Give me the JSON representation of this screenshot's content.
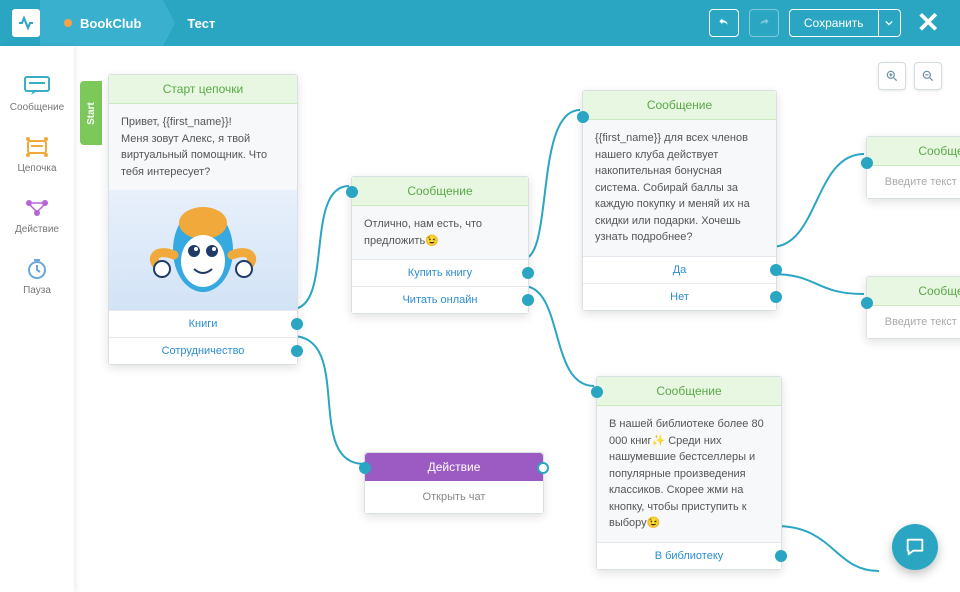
{
  "header": {
    "logo": "⎍",
    "crumb1": "BookClub",
    "crumb2": "Тест",
    "save": "Сохранить"
  },
  "toolbox": {
    "message": "Сообщение",
    "chain": "Цепочка",
    "action": "Действие",
    "pause": "Пауза"
  },
  "start_tab": "Start",
  "nodes": {
    "start": {
      "title": "Старт цепочки",
      "text": "Привет, {{first_name}}!\nМеня зовут Алекс, я твой виртуальный помощник. Что тебя интересует?",
      "opt1": "Книги",
      "opt2": "Сотрудничество"
    },
    "msg1": {
      "title": "Сообщение",
      "text": "Отлично, нам есть, что предложить😉",
      "opt1": "Купить книгу",
      "opt2": "Читать онлайн"
    },
    "msg_bonus": {
      "title": "Сообщение",
      "text": "{{first_name}} для всех членов нашего клуба действует накопительная бонусная система. Собирай баллы за каждую покупку и меняй их на скидки или подарки. Хочешь узнать подробнее?",
      "opt1": "Да",
      "opt2": "Нет"
    },
    "action": {
      "title": "Действие",
      "text": "Открыть чат"
    },
    "library": {
      "title": "Сообщение",
      "text": "В нашей библиотеке более 80 000 книг✨ Среди них нашумевшие бестселлеры и популярные произведения классиков. Скорее жми на кнопку, чтобы приступить к выбору😉",
      "opt1": "В библиотеку"
    },
    "ghost1": {
      "title": "Сообщение",
      "ph": "Введите текст сообщения"
    },
    "ghost2": {
      "title": "Сообщение",
      "ph": "Введите текст сообщения"
    }
  }
}
